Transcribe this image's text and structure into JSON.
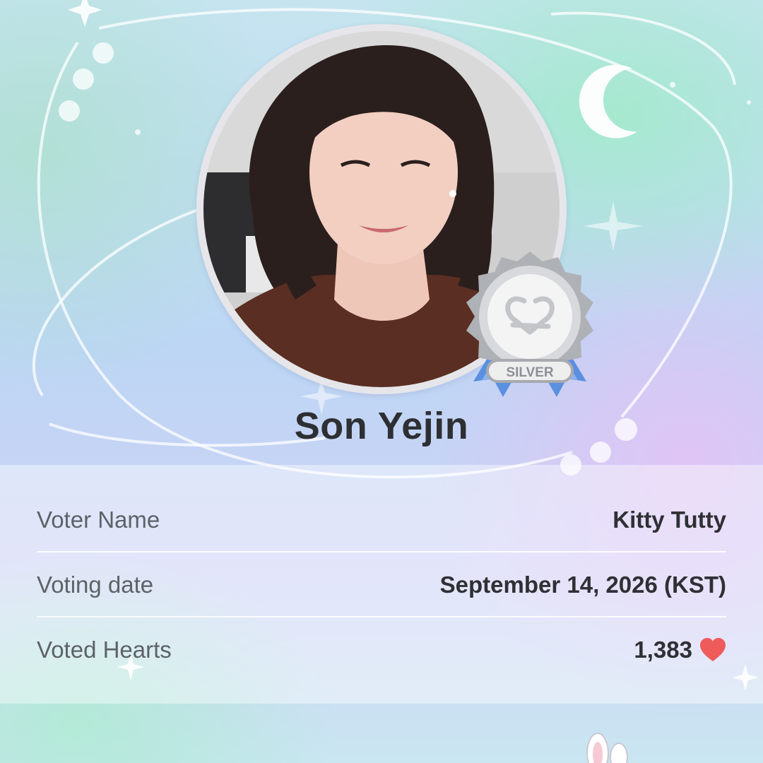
{
  "card": {
    "idol_name": "Son Yejin",
    "badge_icon": "silver-medal-icon",
    "badge_label": "SILVER",
    "avatar": "idol-photo"
  },
  "info": {
    "rows": [
      {
        "label": "Voter Name",
        "value": "Kitty Tutty"
      },
      {
        "label": "Voting date",
        "value": "September 14, 2026 (KST)"
      },
      {
        "label": "Voted Hearts",
        "value": "1,383",
        "icon": "heart-icon"
      }
    ]
  },
  "colors": {
    "heart": "#ef5b5b",
    "text_dark": "#2e2f33",
    "text_label": "#5d6268",
    "badge_ribbon": "#5b8fe0",
    "badge_silver": "#c7c9cc"
  }
}
